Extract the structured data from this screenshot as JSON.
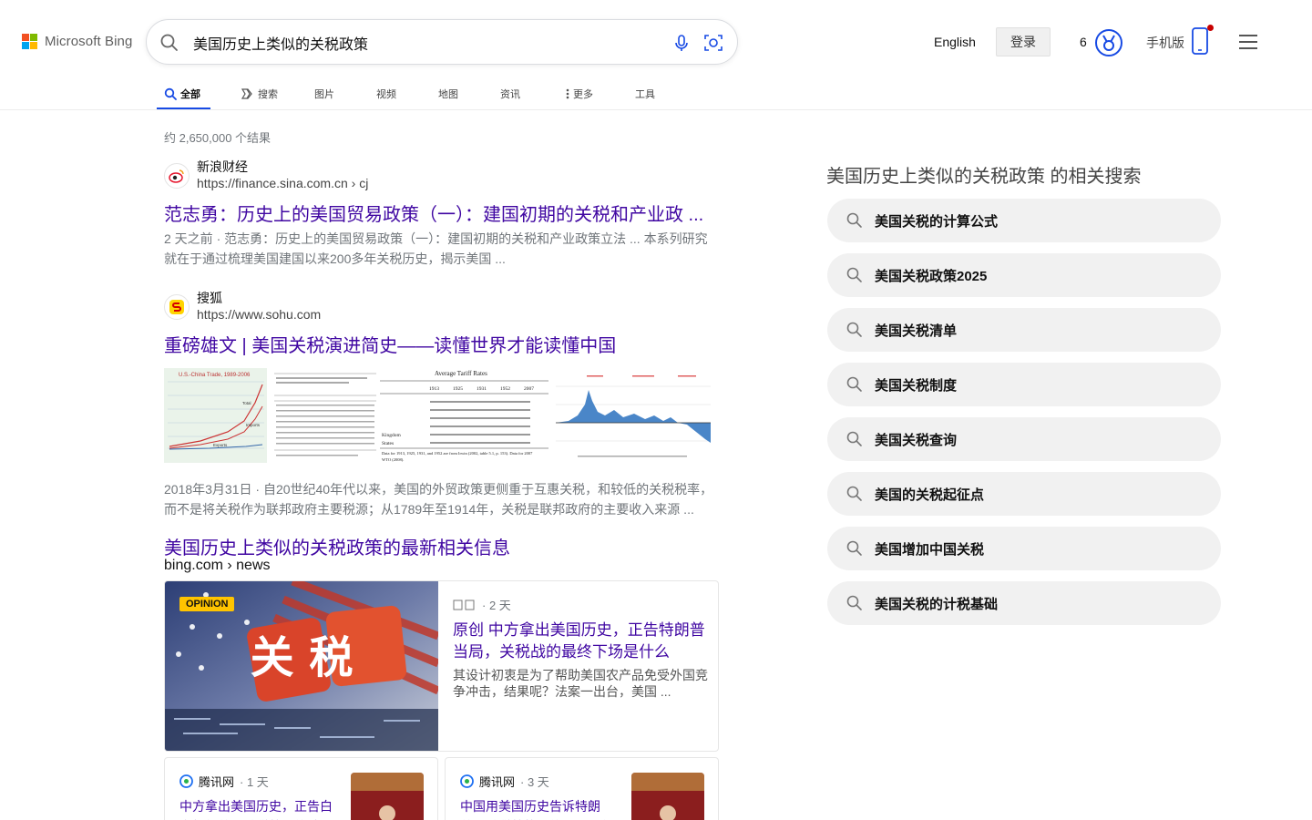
{
  "header": {
    "logo_text": "Microsoft Bing",
    "search_query": "美国历史上类似的关税政策",
    "language": "English",
    "sign_in": "登录",
    "rewards_count": "6",
    "mobile_label": "手机版"
  },
  "tabs": [
    {
      "label": "全部",
      "icon": "search-icon",
      "active": true
    },
    {
      "label": "搜索",
      "icon": "copilot-icon",
      "active": false
    },
    {
      "label": "图片",
      "icon": "",
      "active": false
    },
    {
      "label": "视频",
      "icon": "",
      "active": false
    },
    {
      "label": "地图",
      "icon": "",
      "active": false
    },
    {
      "label": "资讯",
      "icon": "",
      "active": false
    },
    {
      "label": "更多",
      "icon": "more-vertical-icon",
      "active": false
    },
    {
      "label": "工具",
      "icon": "",
      "active": false
    }
  ],
  "results_count": "约 2,650,000 个结果",
  "results": [
    {
      "site_name": "新浪财经",
      "url": "https://finance.sina.com.cn › cj",
      "title": "范志勇：历史上的美国贸易政策（一）：建国初期的关税和产业政 ...",
      "snippet_line1": "2 天之前 · 范志勇：历史上的美国贸易政策（一）：建国初期的关税和产业政策立法 ... 本系列研究",
      "snippet_line2": "就在于通过梳理美国建国以来200多年关税历史，揭示美国 ..."
    },
    {
      "site_name": "搜狐",
      "url": "https://www.sohu.com",
      "title": "重磅雄文 | 美国关税演进简史——读懂世界才能读懂中国",
      "snippet_line1": "2018年3月31日 · 自20世纪40年代以来，美国的外贸政策更侧重于互惠关税，和较低的关税税率，",
      "snippet_line2": "而不是将关税作为联邦政府主要税源；从1789年至1914年，关税是联邦政府的主要收入来源 ..."
    }
  ],
  "image_strip": {
    "thumb1_title": "U.S.-China Trade, 1989-2006",
    "thumb1_labels": [
      "Total",
      "Imports",
      "Exports"
    ],
    "thumb3_title": "Average Tariff Rates",
    "thumb3_years": [
      "1913",
      "1925",
      "1931",
      "1952",
      "2007"
    ],
    "thumb3_rows": [
      "Kingdom",
      "States"
    ],
    "thumb3_footnote1": "Data for 1913, 1925, 1931, and 1952 are from Irwin (2002, table 5.1, p. 153). Data for 2007",
    "thumb3_footnote2": "WTO (2008)."
  },
  "news": {
    "heading": "美国历史上类似的关税政策的最新相关信息",
    "source_url": "bing.com › news",
    "main": {
      "badge": "OPINION",
      "image_text": "关 税",
      "time": "· 2 天",
      "title": "原创 中方拿出美国历史，正告特朗普当局，关税战的最终下场是什么",
      "snippet": "其设计初衷是为了帮助美国农产品免受外国竞争冲击，结果呢？法案一出台，美国 ..."
    },
    "cards": [
      {
        "source": "腾讯网",
        "time": "· 1 天",
        "title": "中方拿出美国历史，正告白宫特朗普，关税战最终结局"
      },
      {
        "source": "腾讯网",
        "time": "· 3 天",
        "title": "中国用美国历史告诉特朗普，关税战的最终下场是什么"
      }
    ]
  },
  "related": {
    "title": "美国历史上类似的关税政策 的相关搜索",
    "items": [
      "美国关税的计算公式",
      "美国关税政策2025",
      "美国关税清单",
      "美国关税制度",
      "美国关税查询",
      "美国的关税起征点",
      "美国增加中国关税",
      "美国关税的计税基础"
    ]
  },
  "colors": {
    "link": "#4007a2",
    "accent": "#174ae4",
    "opinion_badge": "#ffc400"
  }
}
